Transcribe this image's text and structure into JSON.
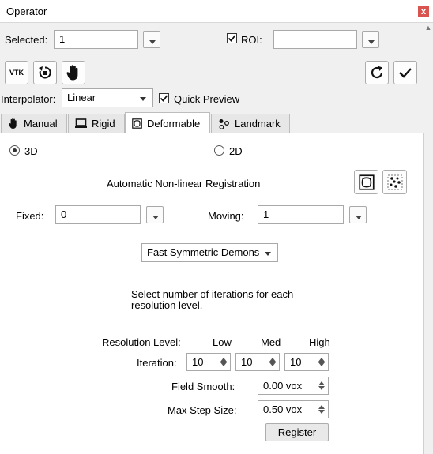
{
  "window": {
    "title": "Operator",
    "close_glyph": "x"
  },
  "selected": {
    "label": "Selected:",
    "value": "1"
  },
  "roi": {
    "label": "ROI:",
    "checked": true,
    "value": ""
  },
  "toolbar": {
    "vtk_label": "VTK"
  },
  "interpolator": {
    "label": "Interpolator:",
    "value": "Linear"
  },
  "quick_preview": {
    "label": "Quick Preview",
    "checked": true
  },
  "tabs": [
    {
      "label": "Manual",
      "icon": "hand-icon"
    },
    {
      "label": "Rigid",
      "icon": "monitor-icon"
    },
    {
      "label": "Deformable",
      "icon": "deformable-icon",
      "active": true
    },
    {
      "label": "Landmark",
      "icon": "landmark-icon"
    }
  ],
  "dimension": {
    "option_3d": "3D",
    "option_2d": "2D",
    "selected": "3D"
  },
  "registration": {
    "heading": "Automatic Non-linear Registration"
  },
  "fixed": {
    "label": "Fixed:",
    "value": "0"
  },
  "moving": {
    "label": "Moving:",
    "value": "1"
  },
  "algorithm": {
    "value": "Fast Symmetric Demons"
  },
  "instructions": {
    "line1": "Select number of iterations for each",
    "line2": "resolution level."
  },
  "resolution": {
    "label": "Resolution Level:",
    "low": "Low",
    "med": "Med",
    "high": "High"
  },
  "iteration": {
    "label": "Iteration:",
    "low": "10",
    "med": "10",
    "high": "10"
  },
  "field_smooth": {
    "label": "Field Smooth:",
    "value": "0.00 vox"
  },
  "max_step": {
    "label": "Max Step Size:",
    "value": "0.50 vox"
  },
  "register_button": {
    "label": "Register"
  }
}
